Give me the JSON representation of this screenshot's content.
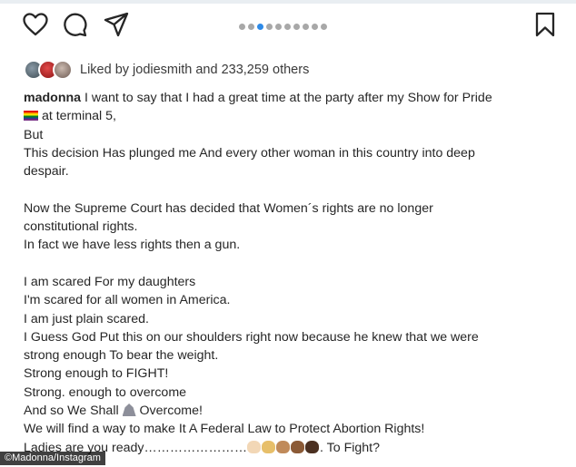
{
  "icons": {
    "like": "heart-icon",
    "comment": "comment-icon",
    "share": "share-icon",
    "save": "bookmark-icon"
  },
  "colors": {
    "pager_active": "#2d8ae8",
    "pager_inactive": "#a8a8a8",
    "text": "#262626"
  },
  "carousel": {
    "total_dots": 10,
    "active_index": 2
  },
  "likes": {
    "prefix": "Liked by ",
    "user": "jodiesmith",
    "middle": " and ",
    "count": "233,259",
    "suffix": " others"
  },
  "caption": {
    "username": "madonna",
    "line1_rest": " I want to say that I had a great time at the party after my Show for Pride",
    "line2": " at terminal 5,",
    "line3": "But",
    "line4": "This decision Has plunged me And every other woman in this country into deep",
    "line5": "despair.",
    "line7": "Now the Supreme Court has decided that Women´s rights are no longer",
    "line8": "constitutional rights.",
    "line9": "In fact we have less rights then a gun.",
    "line11": "I am scared For my daughters",
    "line12": "I'm scared for all women in America.",
    "line13": "I am just plain scared.",
    "line14": "I Guess God Put this on our shoulders right now because he knew that we were",
    "line15": "strong enough To bear the weight.",
    "line16": "Strong enough to FIGHT!",
    "line17": "Strong. enough to overcome",
    "line18_a": "And so We Shall ",
    "line18_b": " Overcome!",
    "line19": "We will find a way to make It A Federal Law to Protect Abortion Rights!",
    "line20_a": "Ladies are you ready……………………",
    "line20_b": ". To Fight?"
  },
  "credit": "©Madonna/Instagram"
}
